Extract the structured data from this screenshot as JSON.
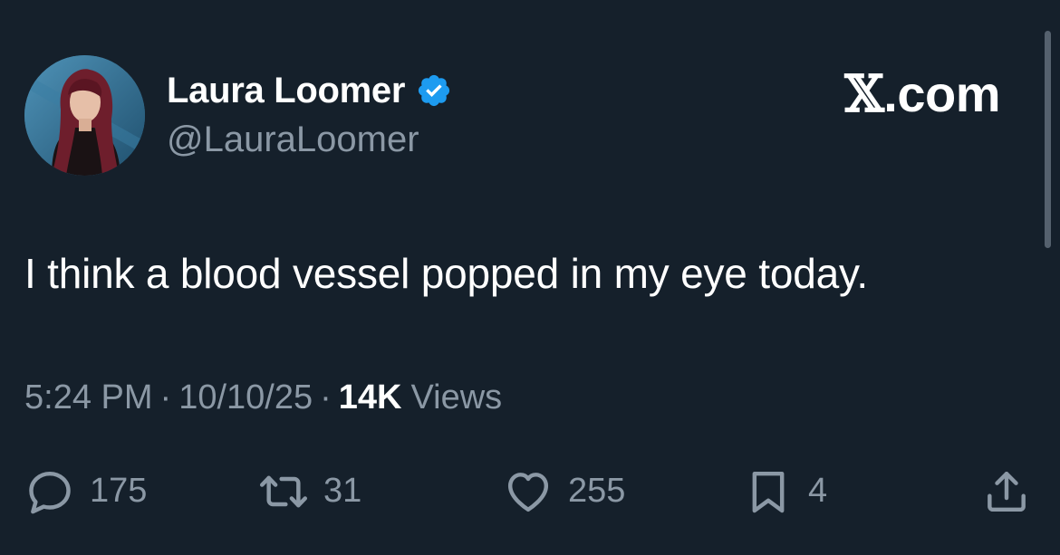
{
  "author": {
    "display_name": "Laura Loomer",
    "handle": "@LauraLoomer",
    "verified": true,
    "verified_color": "#1d9bf0"
  },
  "brand": {
    "x_glyph": "𝕏",
    "suffix": ".com"
  },
  "tweet": {
    "text": "I think a blood vessel popped in my eye today."
  },
  "meta": {
    "time": "5:24 PM",
    "separator": "·",
    "date": "10/10/25",
    "views_count": "14K",
    "views_label": "Views"
  },
  "actions": {
    "replies": {
      "icon": "reply-icon",
      "count": "175"
    },
    "reposts": {
      "icon": "repost-icon",
      "count": "31"
    },
    "likes": {
      "icon": "heart-icon",
      "count": "255"
    },
    "bookmarks": {
      "icon": "bookmark-icon",
      "count": "4"
    },
    "share": {
      "icon": "share-icon"
    }
  },
  "colors": {
    "background": "#15202b",
    "primary_text": "#ffffff",
    "secondary_text": "#8b98a5",
    "verified_blue": "#1d9bf0"
  }
}
